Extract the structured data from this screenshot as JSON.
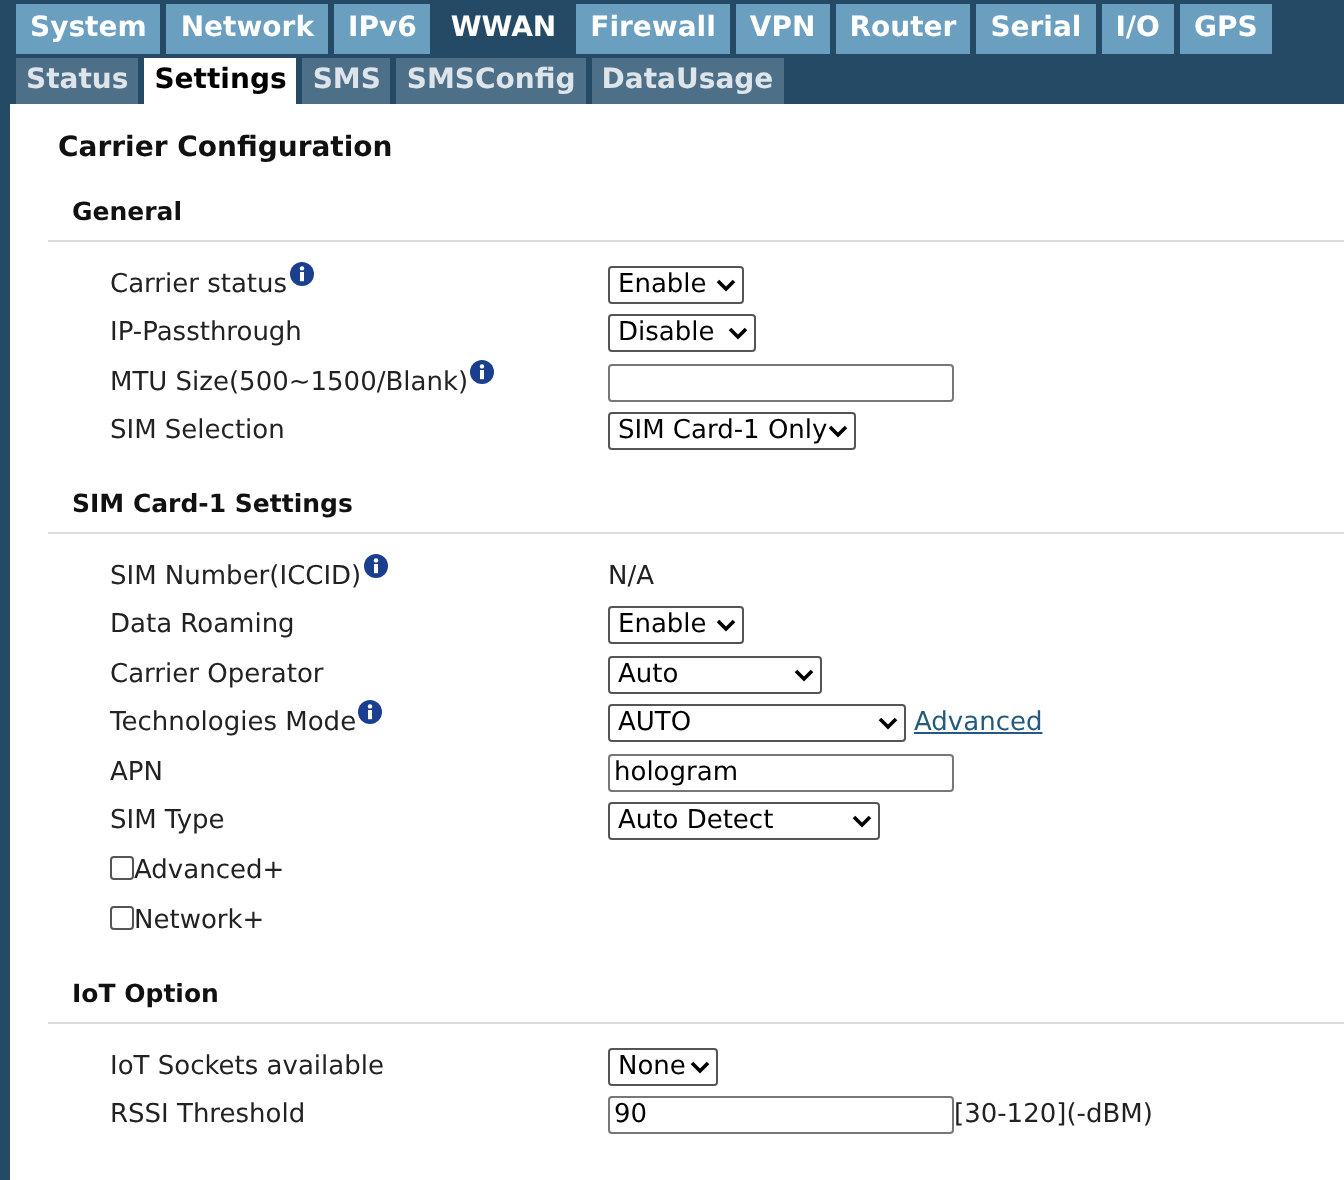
{
  "main_tabs": [
    {
      "label": "System",
      "selected": false
    },
    {
      "label": "Network",
      "selected": false
    },
    {
      "label": "IPv6",
      "selected": false
    },
    {
      "label": "WWAN",
      "selected": true
    },
    {
      "label": "Firewall",
      "selected": false
    },
    {
      "label": "VPN",
      "selected": false
    },
    {
      "label": "Router",
      "selected": false
    },
    {
      "label": "Serial",
      "selected": false
    },
    {
      "label": "I/O",
      "selected": false
    },
    {
      "label": "GPS",
      "selected": false
    }
  ],
  "sub_tabs": [
    {
      "label": "Status",
      "selected": false
    },
    {
      "label": "Settings",
      "selected": true
    },
    {
      "label": "SMS",
      "selected": false
    },
    {
      "label": "SMSConfig",
      "selected": false
    },
    {
      "label": "DataUsage",
      "selected": false
    }
  ],
  "page_title": "Carrier Configuration",
  "sections": [
    {
      "title": "General",
      "rows": [
        {
          "kind": "select",
          "label": "Carrier status",
          "info": true,
          "value": "Enable"
        },
        {
          "kind": "select",
          "label": "IP-Passthrough",
          "info": false,
          "value": "Disable"
        },
        {
          "kind": "input",
          "label": "MTU Size(500~1500/Blank)",
          "info": true
        },
        {
          "kind": "select",
          "label": "SIM Selection",
          "info": false,
          "value": "SIM Card-1 Only"
        }
      ]
    },
    {
      "title": "SIM Card-1 Settings",
      "rows": [
        {
          "kind": "text",
          "label": "SIM Number(ICCID)",
          "info": true,
          "value": "N/A"
        },
        {
          "kind": "select",
          "label": "Data Roaming",
          "info": false,
          "value": "Enable"
        },
        {
          "kind": "select",
          "label": "Carrier Operator",
          "info": false,
          "value": "Auto"
        },
        {
          "kind": "select",
          "label": "Technologies Mode",
          "info": true,
          "value": "AUTO",
          "link": "Advanced"
        },
        {
          "kind": "input",
          "label": "APN",
          "info": false,
          "value": "hologram"
        },
        {
          "kind": "select",
          "label": "SIM Type",
          "info": false,
          "value": "Auto Detect"
        },
        {
          "kind": "checkbox",
          "label": "Advanced+",
          "checked": false
        },
        {
          "kind": "checkbox",
          "label": "Network+",
          "checked": false
        }
      ]
    },
    {
      "title": "IoT Option",
      "rows": [
        {
          "kind": "select",
          "label": "IoT Sockets available",
          "info": false,
          "value": "None"
        },
        {
          "kind": "input",
          "label": "RSSI Threshold",
          "info": false,
          "value": "90",
          "suffix": "[30-120](-dBM)"
        }
      ]
    }
  ]
}
